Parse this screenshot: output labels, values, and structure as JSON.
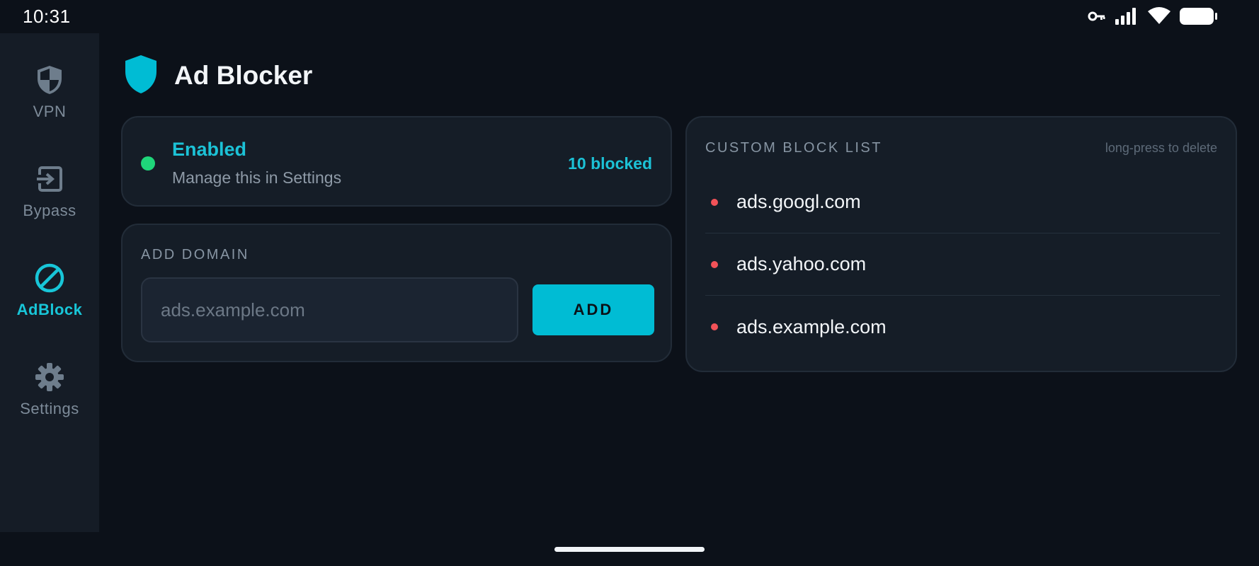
{
  "status_bar": {
    "time": "10:31",
    "icons": [
      "key-icon",
      "signal-icon",
      "wifi-icon",
      "battery-icon"
    ]
  },
  "sidebar": {
    "items": [
      {
        "label": "VPN",
        "icon": "shield-icon",
        "active": false
      },
      {
        "label": "Bypass",
        "icon": "bypass-icon",
        "active": false
      },
      {
        "label": "AdBlock",
        "icon": "block-icon",
        "active": true
      },
      {
        "label": "Settings",
        "icon": "gear-icon",
        "active": false
      }
    ]
  },
  "header": {
    "title": "Ad Blocker",
    "icon": "shield-icon"
  },
  "status_card": {
    "title": "Enabled",
    "subtitle": "Manage this in Settings",
    "blocked": "10 blocked"
  },
  "add_domain": {
    "label": "ADD DOMAIN",
    "value": "",
    "placeholder": "ads.example.com",
    "button_label": "ADD"
  },
  "block_list": {
    "label": "CUSTOM BLOCK LIST",
    "hint": "long-press to delete",
    "items": [
      "ads.googl.com",
      "ads.yahoo.com",
      "ads.example.com"
    ]
  },
  "colors": {
    "accent": "#00bcd4",
    "enabled_dot": "#1fd67a",
    "list_bullet": "#f25258",
    "background": "#0c1119",
    "card": "#151d27"
  }
}
